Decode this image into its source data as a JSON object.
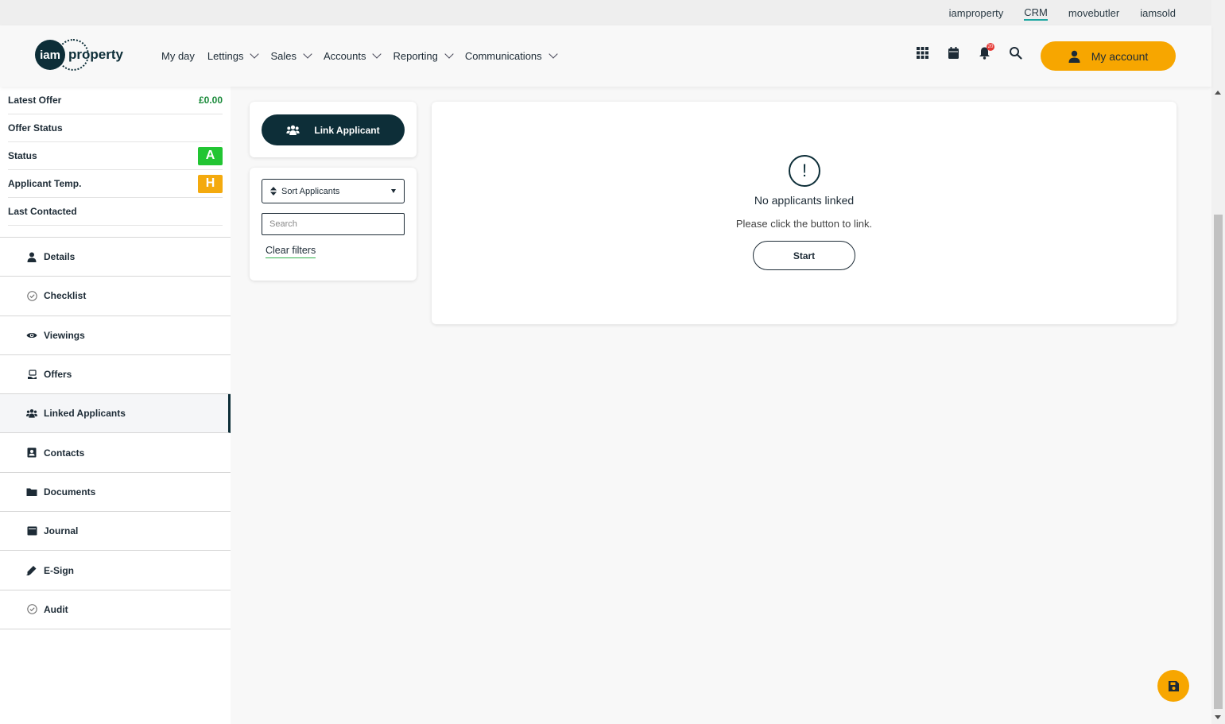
{
  "topbar": {
    "links": [
      "iamproperty",
      "CRM",
      "movebutler",
      "iamsold"
    ],
    "active": "CRM"
  },
  "header": {
    "logo_circle": "iam",
    "logo_word": "property",
    "nav": [
      "My day",
      "Lettings",
      "Sales",
      "Accounts",
      "Reporting",
      "Communications"
    ],
    "notification_count": "20",
    "account_label": "My account"
  },
  "summary": {
    "latest_offer_label": "Latest Offer",
    "latest_offer_value": "£0.00",
    "offer_status_label": "Offer Status",
    "status_label": "Status",
    "status_value": "A",
    "applicant_temp_label": "Applicant Temp.",
    "applicant_temp_value": "H",
    "last_contacted_label": "Last Contacted"
  },
  "menu": [
    "Details",
    "Checklist",
    "Viewings",
    "Offers",
    "Linked Applicants",
    "Contacts",
    "Documents",
    "Journal",
    "E-Sign",
    "Audit"
  ],
  "filters": {
    "link_button": "Link Applicant",
    "sort_label": "Sort Applicants",
    "search_placeholder": "Search",
    "clear_label": "Clear filters"
  },
  "empty_state": {
    "icon": "!",
    "title": "No applicants linked",
    "subtitle": "Please click the button to link.",
    "start_label": "Start"
  },
  "colors": {
    "brand_dark": "#0d2e38",
    "accent": "#f7a600",
    "status_green": "#22c533",
    "temp_orange": "#f4aa0e"
  }
}
